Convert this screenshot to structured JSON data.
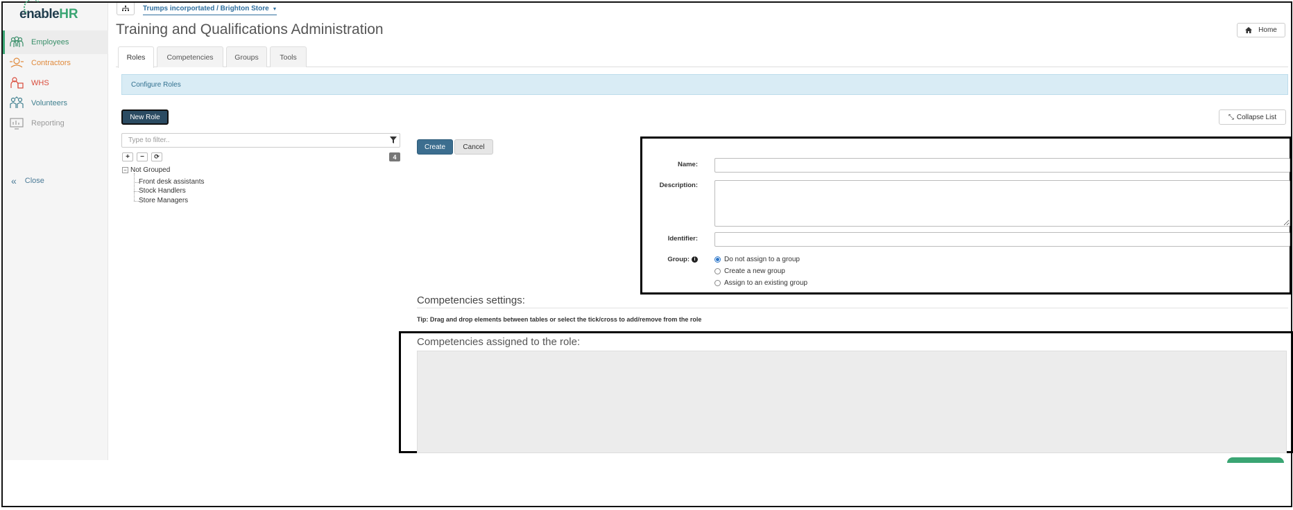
{
  "brand": {
    "enable": "enable",
    "hr": "HR"
  },
  "sidebar": {
    "items": [
      {
        "label": "Employees",
        "icon": "employees-icon",
        "color": "#3a8f6a",
        "active": true
      },
      {
        "label": "Contractors",
        "icon": "contractors-icon",
        "color": "#e08a3c",
        "active": false
      },
      {
        "label": "WHS",
        "icon": "whs-icon",
        "color": "#d94a3a",
        "active": false
      },
      {
        "label": "Volunteers",
        "icon": "volunteers-icon",
        "color": "#3f7f8f",
        "active": false
      },
      {
        "label": "Reporting",
        "icon": "reporting-icon",
        "color": "#9a9a9a",
        "active": false
      }
    ],
    "close_label": "Close"
  },
  "header": {
    "org_path": "Trumps incorportated / Brighton Store",
    "home_label": "Home"
  },
  "page": {
    "title": "Training and Qualifications Administration"
  },
  "tabs": [
    {
      "label": "Roles",
      "active": true
    },
    {
      "label": "Competencies",
      "active": false
    },
    {
      "label": "Groups",
      "active": false
    },
    {
      "label": "Tools",
      "active": false
    }
  ],
  "info_bar": "Configure Roles",
  "toolbar": {
    "new_role_label": "New Role",
    "collapse_label": "Collapse List"
  },
  "tree": {
    "filter_placeholder": "Type to filter..",
    "count": "4",
    "root_label": "Not Grouped",
    "children": [
      "Front desk assistants",
      "Stock Handlers",
      "Store Managers"
    ]
  },
  "form": {
    "create_label": "Create",
    "cancel_label": "Cancel",
    "name_label": "Name:",
    "name_value": "",
    "description_label": "Description:",
    "description_value": "",
    "identifier_label": "Identifier:",
    "identifier_value": "",
    "group_label": "Group:",
    "group_options": [
      {
        "label": "Do not assign to a group",
        "checked": true
      },
      {
        "label": "Create a new group",
        "checked": false
      },
      {
        "label": "Assign to an existing group",
        "checked": false
      }
    ]
  },
  "competencies": {
    "settings_heading": "Competencies settings:",
    "tip": "Tip: Drag and drop elements between tables or select the tick/cross to add/remove from the role",
    "assigned_heading": "Competencies assigned to the role:"
  },
  "colors": {
    "accent_green": "#3aa573",
    "primary_button": "#3c6e8f",
    "dark_button": "#2b4b62",
    "info_bg": "#d9ecf5"
  }
}
